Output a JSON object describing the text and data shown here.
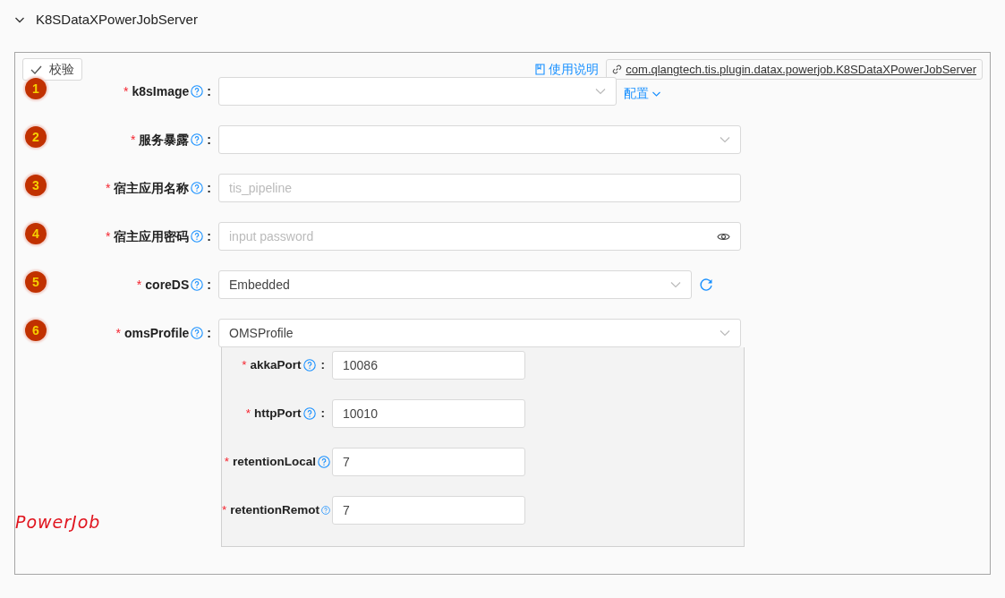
{
  "section": {
    "title": "K8SDataXPowerJobServer",
    "expanded": true
  },
  "toolbar": {
    "validate_button": "校验",
    "help_link": "使用说明",
    "plugin_link": "com.qlangtech.tis.plugin.datax.powerjob.K8SDataXPowerJobServer"
  },
  "fields": [
    {
      "index": "1",
      "required_mark": "*",
      "label": "k8sImage",
      "suffix": ":",
      "kind": "select",
      "addon": {
        "kind": "dropdown",
        "label": "配置"
      }
    },
    {
      "index": "2",
      "required_mark": "*",
      "label": "服务暴露",
      "suffix": ":",
      "kind": "select"
    },
    {
      "index": "3",
      "required_mark": "*",
      "label": "宿主应用名称",
      "suffix": ":",
      "kind": "input",
      "placeholder": "tis_pipeline"
    },
    {
      "index": "4",
      "required_mark": "*",
      "label": "宿主应用密码",
      "suffix": ":",
      "kind": "password",
      "placeholder": "input password"
    },
    {
      "index": "5",
      "required_mark": "*",
      "label": "coreDS",
      "suffix": ":",
      "kind": "select",
      "value": "Embedded",
      "addon": {
        "kind": "refresh"
      }
    },
    {
      "index": "6",
      "required_mark": "*",
      "label": "omsProfile",
      "suffix": ":",
      "kind": "select",
      "value": "OMSProfile",
      "children": [
        {
          "required_mark": "*",
          "label": "akkaPort",
          "suffix": ":",
          "kind": "input",
          "value": "10086"
        },
        {
          "required_mark": "*",
          "label": "httpPort",
          "suffix": ":",
          "kind": "input",
          "value": "10010"
        },
        {
          "required_mark": "*",
          "label": "retentionLocal",
          "kind": "input",
          "value": "7"
        },
        {
          "required_mark": "*",
          "label": "retentionRemot",
          "kind": "input",
          "value": "7"
        }
      ]
    }
  ],
  "logo": "PowerJob"
}
